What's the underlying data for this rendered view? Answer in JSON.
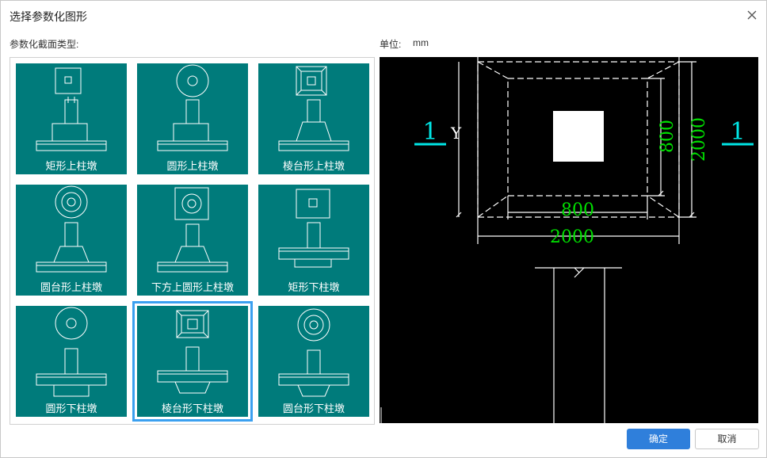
{
  "dialog": {
    "title": "选择参数化图形",
    "section_label": "参数化截面类型:",
    "unit_label": "单位:",
    "unit_value": "mm"
  },
  "shapes": [
    {
      "label": "矩形上柱墩",
      "icon": "rect-upper-pier-icon"
    },
    {
      "label": "圆形上柱墩",
      "icon": "circle-upper-pier-icon"
    },
    {
      "label": "棱台形上柱墩",
      "icon": "frustum-upper-pier-icon"
    },
    {
      "label": "圆台形上柱墩",
      "icon": "round-frustum-upper-pier-icon"
    },
    {
      "label": "下方上圆形上柱墩",
      "icon": "square-bottom-round-top-pier-icon"
    },
    {
      "label": "矩形下柱墩",
      "icon": "rect-lower-pier-icon"
    },
    {
      "label": "圆形下柱墩",
      "icon": "circle-lower-pier-icon"
    },
    {
      "label": "棱台形下柱墩",
      "icon": "frustum-lower-pier-icon",
      "selected": true
    },
    {
      "label": "圆台形下柱墩",
      "icon": "round-frustum-lower-pier-icon"
    }
  ],
  "preview": {
    "section_mark": "1",
    "axis_label": "Y",
    "dim_inner": "800",
    "dim_outer": "2000",
    "dim_inner_vertical": "800",
    "dim_outer_vertical": "2000"
  },
  "buttons": {
    "ok": "确定",
    "cancel": "取消"
  },
  "colors": {
    "tile": "#007b7b",
    "selection": "#3ba0f0",
    "dimension_text": "#00e000",
    "section_mark": "#00e5e5",
    "ok_button": "#2f7fdb"
  }
}
